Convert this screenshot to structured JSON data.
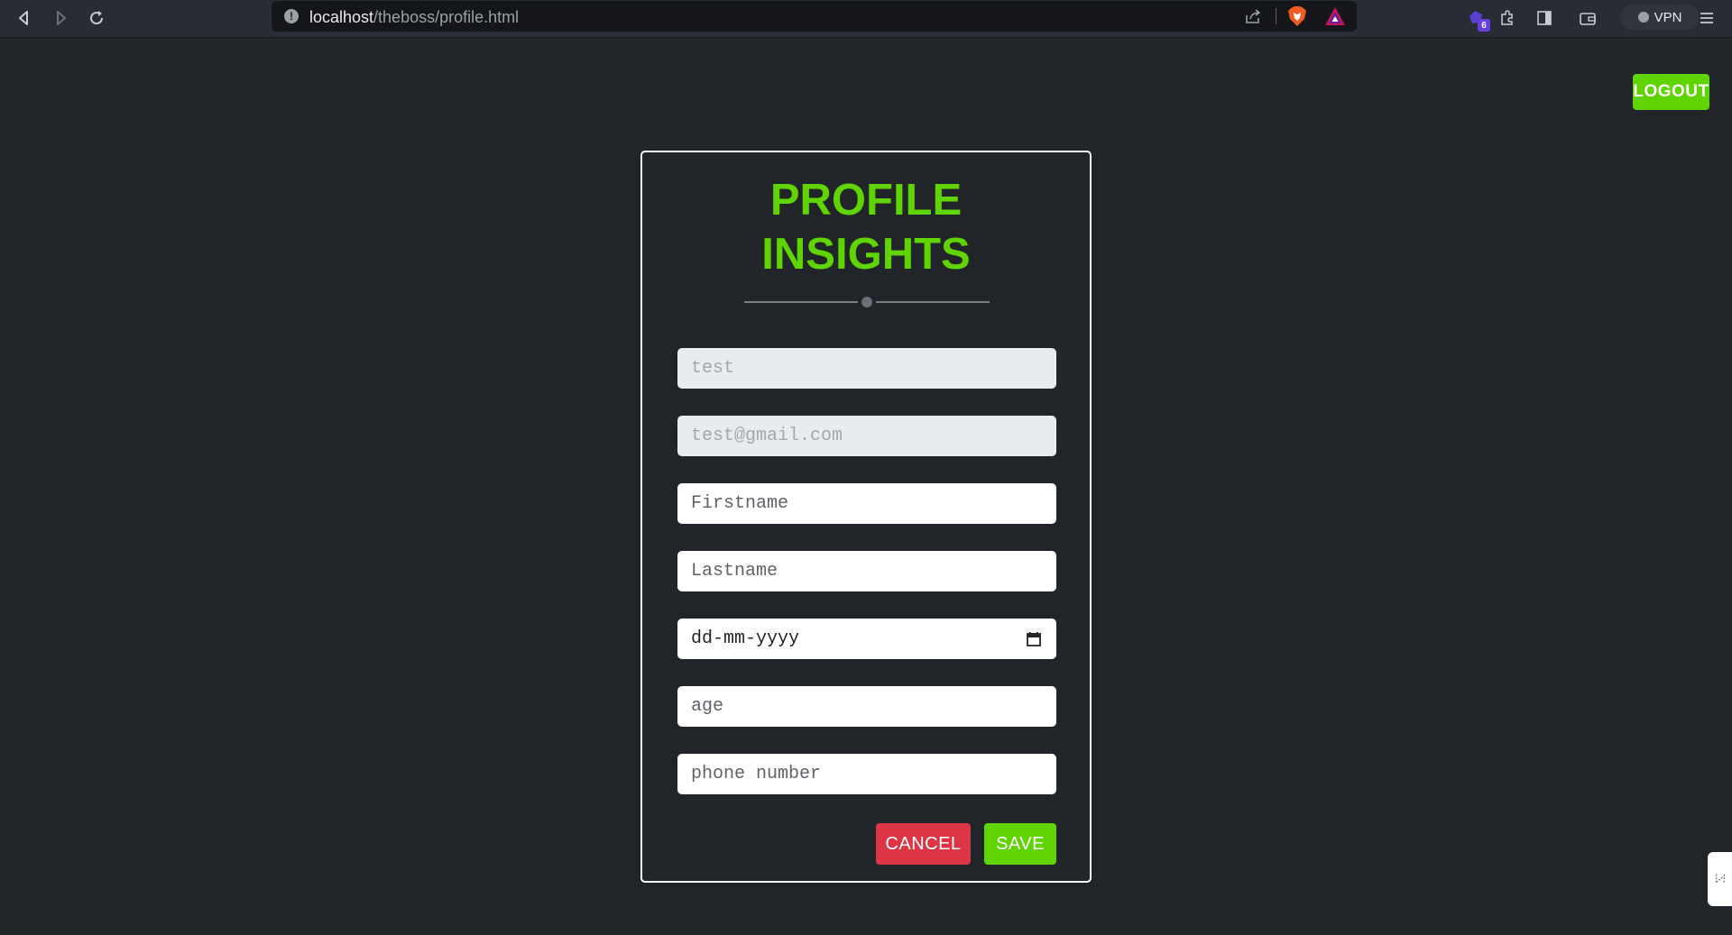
{
  "browser": {
    "url_host": "localhost",
    "url_path": "/theboss/profile.html",
    "extension_badge_count": "6",
    "vpn_label": "VPN"
  },
  "page": {
    "logout_label": "LOGOUT",
    "title_line1": "PROFILE",
    "title_line2": "INSIGHTS",
    "form": {
      "username_placeholder": "test",
      "email_placeholder": "test@gmail.com",
      "firstname_placeholder": "Firstname",
      "lastname_placeholder": "Lastname",
      "dob_placeholder": "dd-mm-yyyy",
      "age_placeholder": "age",
      "phone_placeholder": "phone number"
    },
    "cancel_label": "CANCEL",
    "save_label": "SAVE"
  },
  "colors": {
    "accent": "#5fd400",
    "danger": "#dc3545",
    "background": "#212428"
  }
}
